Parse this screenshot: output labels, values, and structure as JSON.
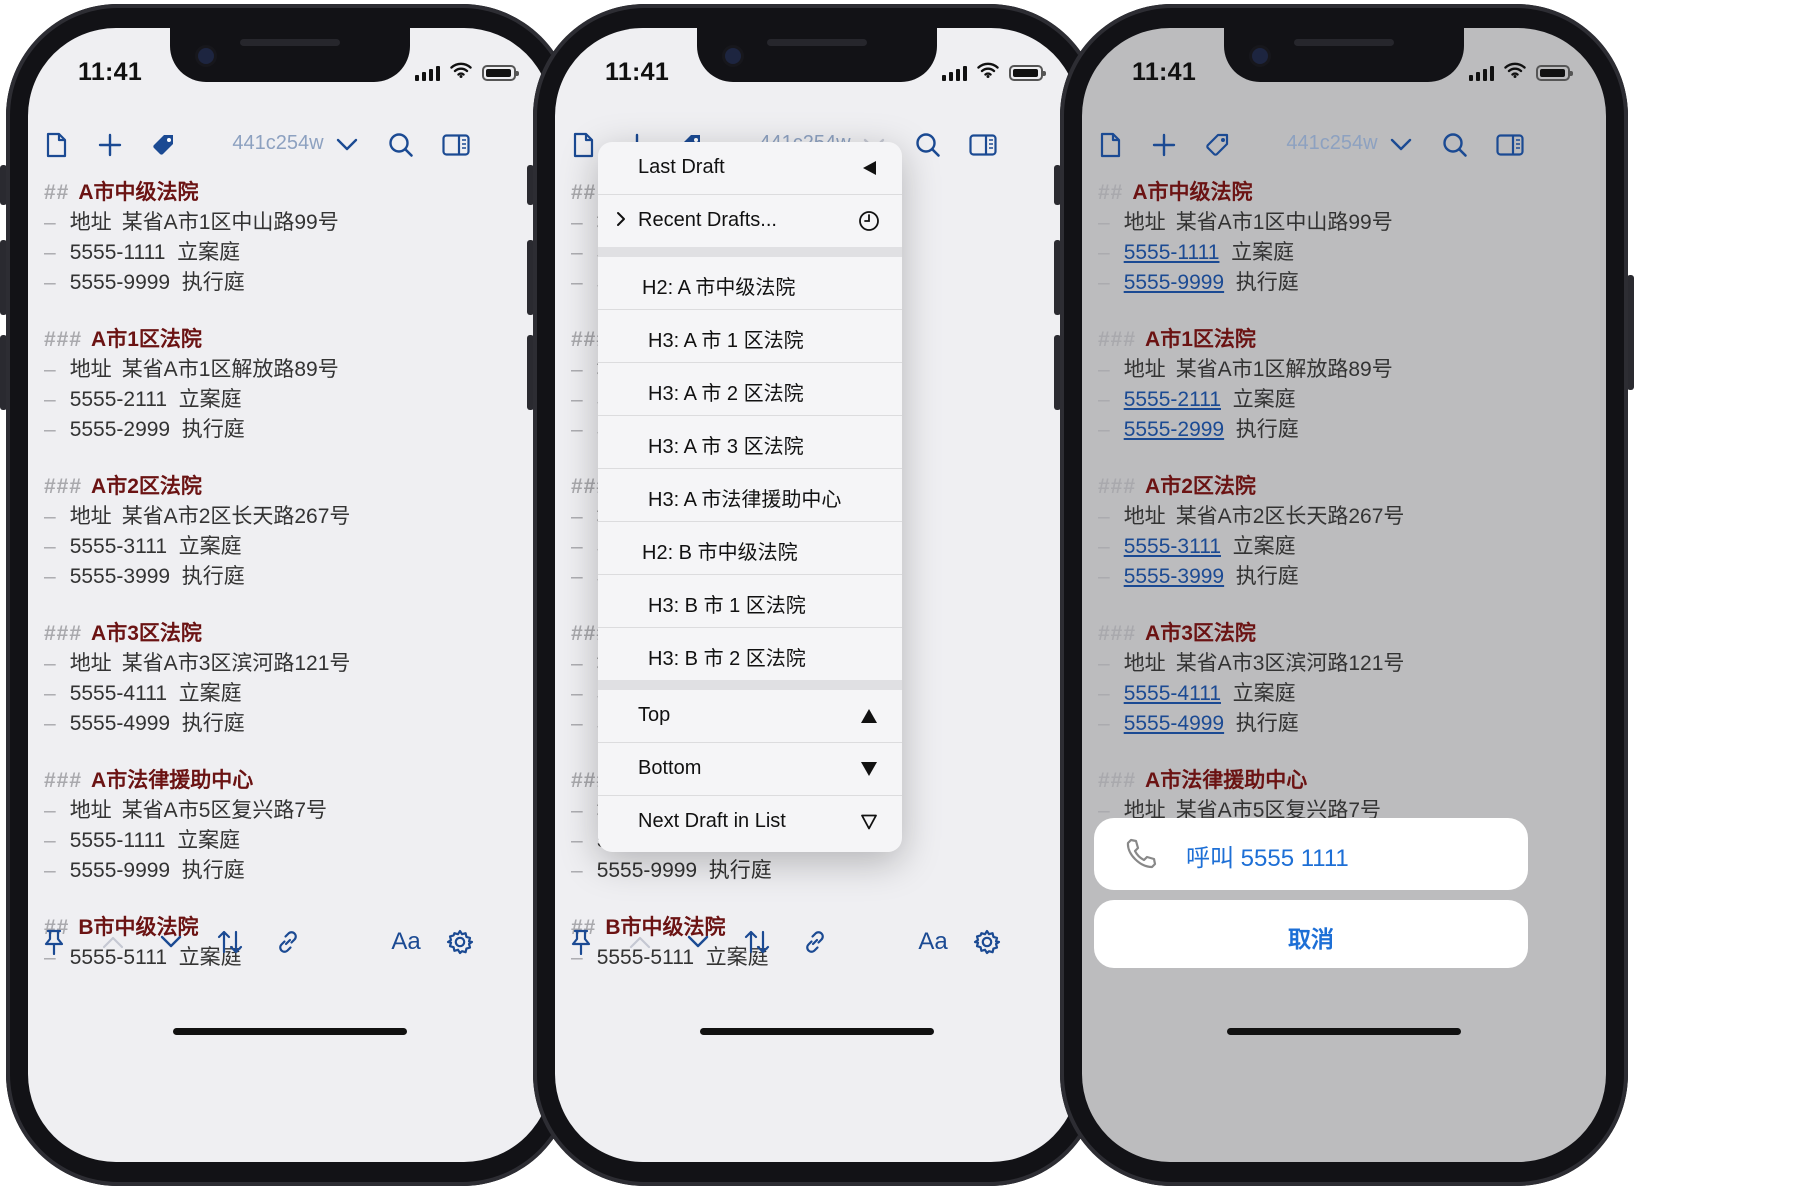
{
  "status": {
    "time": "11:41"
  },
  "toolbar": {
    "title": "441c254w",
    "font_label": "Aa"
  },
  "document": [
    {
      "hashes": "##",
      "title": "A市中级法院",
      "lines": [
        {
          "kind": "addr",
          "label": "地址",
          "value": "某省A市1区中山路99号"
        },
        {
          "kind": "phone",
          "phone": "5555-1111",
          "desc": "立案庭"
        },
        {
          "kind": "phone",
          "phone": "5555-9999",
          "desc": "执行庭"
        }
      ]
    },
    {
      "hashes": "###",
      "title": "A市1区法院",
      "lines": [
        {
          "kind": "addr",
          "label": "地址",
          "value": "某省A市1区解放路89号"
        },
        {
          "kind": "phone",
          "phone": "5555-2111",
          "desc": "立案庭"
        },
        {
          "kind": "phone",
          "phone": "5555-2999",
          "desc": "执行庭"
        }
      ]
    },
    {
      "hashes": "###",
      "title": "A市2区法院",
      "lines": [
        {
          "kind": "addr",
          "label": "地址",
          "value": "某省A市2区长天路267号"
        },
        {
          "kind": "phone",
          "phone": "5555-3111",
          "desc": "立案庭"
        },
        {
          "kind": "phone",
          "phone": "5555-3999",
          "desc": "执行庭"
        }
      ]
    },
    {
      "hashes": "###",
      "title": "A市3区法院",
      "lines": [
        {
          "kind": "addr",
          "label": "地址",
          "value": "某省A市3区滨河路121号"
        },
        {
          "kind": "phone",
          "phone": "5555-4111",
          "desc": "立案庭"
        },
        {
          "kind": "phone",
          "phone": "5555-4999",
          "desc": "执行庭"
        }
      ]
    },
    {
      "hashes": "###",
      "title": "A市法律援助中心",
      "lines": [
        {
          "kind": "addr",
          "label": "地址",
          "value": "某省A市5区复兴路7号"
        },
        {
          "kind": "phone",
          "phone": "5555-1111",
          "desc": "立案庭"
        },
        {
          "kind": "phone",
          "phone": "5555-9999",
          "desc": "执行庭"
        }
      ]
    },
    {
      "hashes": "##",
      "title": "B市中级法院",
      "lines": [
        {
          "kind": "phone",
          "phone": "5555-5111",
          "desc": "立案庭"
        }
      ]
    }
  ],
  "nav_menu": {
    "items": [
      {
        "label": "Last Draft",
        "icon": "triangle-left-icon"
      },
      {
        "label": "Recent Drafts...",
        "icon": "clock-icon",
        "chevron": true
      },
      {
        "sep": true
      },
      {
        "label": "H2: A 市中级法院",
        "indent": 1
      },
      {
        "label": "H3: A 市 1 区法院",
        "indent": 2
      },
      {
        "label": "H3: A 市 2 区法院",
        "indent": 2
      },
      {
        "label": "H3: A 市 3 区法院",
        "indent": 2
      },
      {
        "label": "H3: A 市法律援助中心",
        "indent": 2
      },
      {
        "label": "H2: B 市中级法院",
        "indent": 1
      },
      {
        "label": "H3: B 市 1 区法院",
        "indent": 2
      },
      {
        "label": "H3: B 市 2 区法院",
        "indent": 2
      },
      {
        "sep": true
      },
      {
        "label": "Top",
        "icon": "triangle-up-icon"
      },
      {
        "label": "Bottom",
        "icon": "triangle-down-icon"
      },
      {
        "label": "Next Draft in List",
        "icon": "triangle-down-outline-icon"
      }
    ]
  },
  "action_sheet": {
    "call_label": "呼叫 5555 1111",
    "cancel_label": "取消"
  },
  "colors": {
    "accent": "#1b4a93",
    "heading": "#6b1313",
    "link": "#1d6fd6"
  }
}
